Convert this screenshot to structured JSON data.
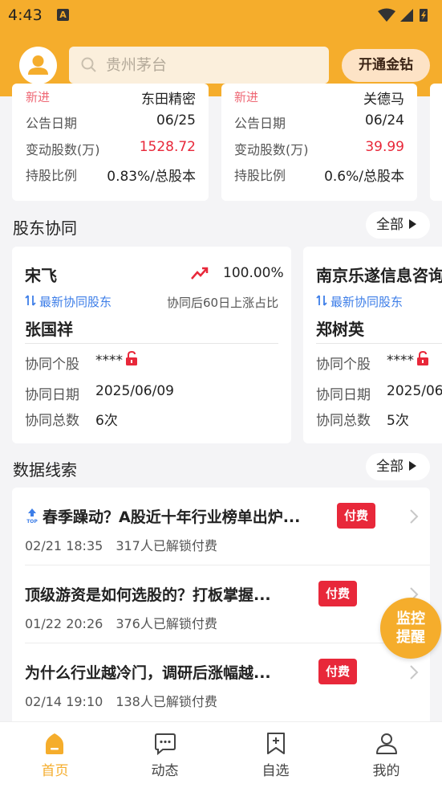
{
  "status": {
    "time": "4:43",
    "app_icon": "A"
  },
  "header": {
    "search_placeholder": "贵州茅台",
    "vip_label": "开通金钻"
  },
  "top_cards": [
    {
      "partial_tag": "新进",
      "partial_name": "东田精密",
      "date_label": "公告日期",
      "date": "06/25",
      "shares_label": "变动股数(万)",
      "shares": "1528.72",
      "ratio_label": "持股比例",
      "ratio": "0.83%/总股本"
    },
    {
      "partial_tag": "新进",
      "partial_name": "关德马",
      "date_label": "公告日期",
      "date": "06/24",
      "shares_label": "变动股数(万)",
      "shares": "39.99",
      "ratio_label": "持股比例",
      "ratio": "0.6%/总股本"
    }
  ],
  "holders_section": {
    "title": "股东协同",
    "all_label": "全部",
    "cards": [
      {
        "name": "宋飞",
        "pct": "100.00%",
        "tag": "最新协同股东",
        "sub": "协同后60日上涨占比",
        "partner": "张国祥",
        "stock_label": "协同个股",
        "stock_value": "****",
        "date_label": "协同日期",
        "date": "2025/06/09",
        "count_label": "协同总数",
        "count": "6次"
      },
      {
        "name": "南京乐遂信息咨询",
        "tag": "最新协同股东",
        "partner": "郑树英",
        "stock_label": "协同个股",
        "stock_value": "****",
        "date_label": "协同日期",
        "date": "2025/06",
        "count_label": "协同总数",
        "count": "5次"
      }
    ]
  },
  "clues_section": {
    "title": "数据线索",
    "all_label": "全部",
    "items": [
      {
        "title": "春季躁动？A股近十年行业榜单出炉...",
        "time": "02/21 18:35",
        "unlocks": "317人已解锁付费",
        "badge": "付费",
        "top": true
      },
      {
        "title": "顶级游资是如何选股的？打板掌握...",
        "time": "01/22 20:26",
        "unlocks": "376人已解锁付费",
        "badge": "付费",
        "top": false
      },
      {
        "title": "为什么行业越冷门，调研后涨幅越...",
        "time": "02/14 19:10",
        "unlocks": "138人已解锁付费",
        "badge": "付费",
        "top": false
      }
    ]
  },
  "float_button": {
    "line1": "监控",
    "line2": "提醒"
  },
  "tabbar": {
    "tabs": [
      {
        "label": "首页",
        "icon": "home-icon",
        "active": true
      },
      {
        "label": "动态",
        "icon": "message-icon",
        "active": false
      },
      {
        "label": "自选",
        "icon": "bookmark-add-icon",
        "active": false
      },
      {
        "label": "我的",
        "icon": "user-icon",
        "active": false
      }
    ]
  },
  "colors": {
    "brand": "#f5ad2c",
    "red": "#e8283a",
    "blue": "#3d7ee8"
  }
}
